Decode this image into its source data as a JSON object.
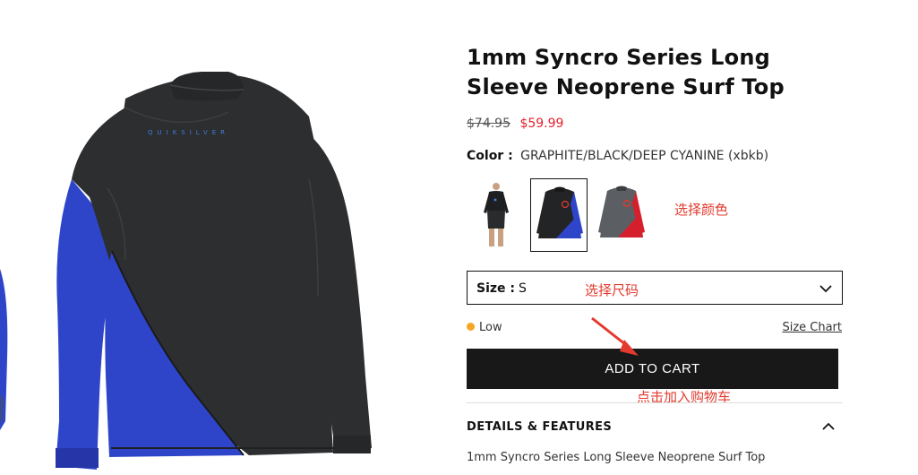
{
  "product": {
    "title": "1mm Syncro Series Long Sleeve Neoprene Surf Top",
    "price_original": "$74.95",
    "price_sale": "$59.99",
    "brand_print": "QUIKSILVER"
  },
  "color": {
    "label": "Color :",
    "value": "GRAPHITE/BLACK/DEEP CYANINE (xbkb)",
    "swatches": [
      "model-photo",
      "graphite-black-deep-cyanine",
      "grey-red"
    ],
    "selected_index": 1
  },
  "size": {
    "label": "Size :",
    "value": "S"
  },
  "stock": {
    "status": "Low",
    "size_chart_label": "Size Chart"
  },
  "cart": {
    "button_label": "ADD TO CART"
  },
  "details": {
    "header": "DETAILS & FEATURES",
    "text": "1mm Syncro Series Long Sleeve Neoprene Surf Top"
  },
  "annotations": {
    "select_color": "选择颜色",
    "select_size": "选择尺码",
    "add_to_cart": "点击加入购物车"
  },
  "colors": {
    "accent_red": "#e5202e",
    "annotation_red": "#e23b2e",
    "stock_low": "#f5a623",
    "button_bg": "#181818",
    "wetsuit_black": "#2d2e30",
    "wetsuit_blue": "#2f45c9"
  }
}
